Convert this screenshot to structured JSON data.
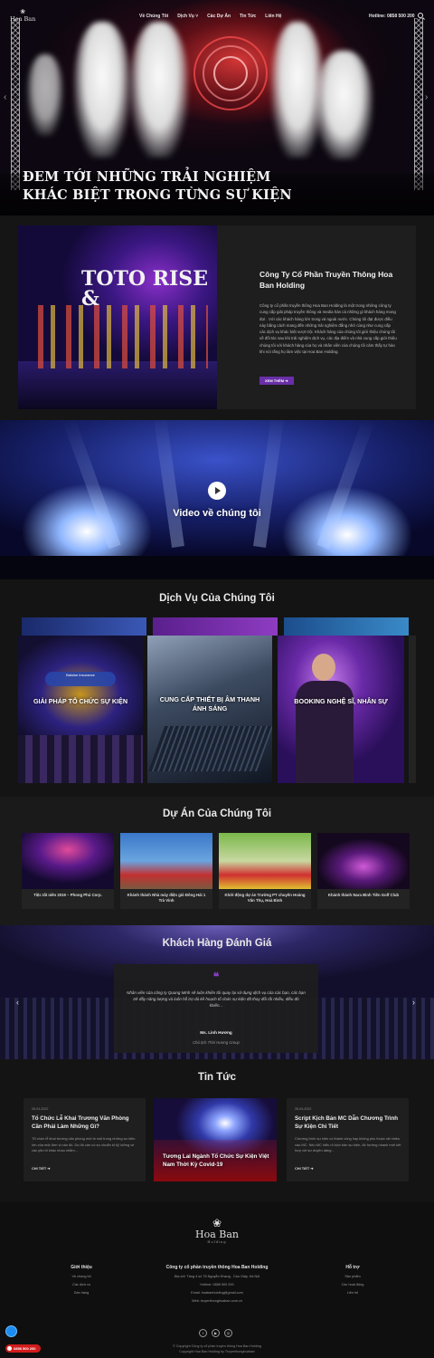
{
  "header": {
    "logo": "Hoa Ban",
    "nav": [
      "Về Chúng Tôi",
      "Dịch Vụ ˅",
      "Các Dự Án",
      "Tin Tức",
      "Liên Hệ"
    ],
    "hotline": "Hotline: 0858 500 200"
  },
  "hero": {
    "title_line1": "ĐEM TỚI NHỮNG TRẢI NGHIỆM",
    "title_line2": "KHÁC BIỆT TRONG TỪNG SỰ KIỆN"
  },
  "about": {
    "title": "Công Ty Cổ Phần Truyền Thông Hoa Ban Holding",
    "body": "Công ty cổ phần truyền thông Hoa Ban Holding là một trong những công ty cung cấp giải pháp truyền thông và media hàn cá những gì khách hàng mong đợi . Với các khách hàng lớn trong và ngoài nước. Chúng tôi đạt được điều này bằng cách mang đến những trải nghiệm đẳng nhớ cùng như cung cấp các dịch vụ khác biệt vượt trội. Khách hàng của chúng tôi giới thiệu chúng tôi về đối tác sau khi trải nghiệm dịch vụ, các địa điểm và nhà cung cấp giới thiệu chúng tôi với khách hàng của họ và nhân viên của chúng tôi cảm thấy tự hào khi nói rằng họ làm việc tại Hoa Ban Holding.",
    "button": "XEM THÊM ➜",
    "image_text": "TOTO RISE &"
  },
  "video": {
    "title": "Video về chúng tôi"
  },
  "services": {
    "title": "Dịch Vụ Của Chúng Tôi",
    "items": [
      {
        "label": "GIẢI PHÁP TỔ CHỨC SỰ KIỆN",
        "img_text": "Baloise Insurance"
      },
      {
        "label": "CUNG CẤP THIẾT BỊ ÂM THANH ÁNH SÁNG"
      },
      {
        "label": "BOOKING NGHỆ SĨ, NHÂN SỰ"
      }
    ]
  },
  "projects": {
    "title": "Dự Án Của Chúng Tôi",
    "items": [
      {
        "caption": "Tiệc tất niên 2019 – Phong Phú Corp."
      },
      {
        "caption": "Khánh thành Nhà máy điện gió Đông Hải 1 Trà Vinh"
      },
      {
        "caption": "Khởi động dự án Trường PT chuyên Hoàng Văn Thụ, Hoà Bình"
      },
      {
        "caption": "Khánh thành Nara Bình Tiên Golf Club"
      }
    ]
  },
  "reviews": {
    "title": "Khách Hàng Đánh Giá",
    "quote_mark": "❝",
    "text": "Nhân viên của công ty Quang Minh sẽ luôn khiến tôi quay lại sử dụng dịch vụ của các bạn, các bạn trẻ đầy năng lượng và luôn hỗ trợ dù kế hoạch tổ chức sự kiện đã thay đổi rồi nhiều, điều đó khiến...",
    "name": "Ms. Linh Hương",
    "role": "Chủ tịch Thời Hương Group"
  },
  "news": {
    "title": "Tin Tức",
    "items": [
      {
        "date": "26-04-2022",
        "title": "Tổ Chức Lễ Khai Trương Văn Phòng Cần Phải Làm Những Gì?",
        "body": "Tổ chức lễ khai trương văn phòng mới là một trong những sự kiện lớn của một đơn vị nào đó. Do đó cần có sự chuẩn bị kỹ lưỡng về các yếu tố khác nhau nhằm...",
        "more": "CHI TIẾT ➜"
      },
      {
        "title": "Tương Lai Ngành Tổ Chức Sự Kiện Việt Nam Thời Kỳ Covid-19"
      },
      {
        "date": "26-04-2022",
        "title": "Script Kịch Bản MC Dẫn Chương Trình Sự Kiện Chi Tiết",
        "body": "Chương trình sự kiện có thành công hay không phụ thuộc rất nhiều vào MC. Nếu MC hiểu rõ kịch bản sự kiện, đồ hướng nhanh mới kết hợp với sự duyên dáng...",
        "more": "CHI TIẾT ➜"
      }
    ]
  },
  "footer": {
    "logo": "Hoa Ban",
    "logo_sub": "Holding",
    "col1_title": "Giới thiệu",
    "col1_links": [
      "Về chúng tôi",
      "Các dịch vụ",
      "Dàn hàng"
    ],
    "col2_title": "Công ty cổ phần truyền thông Hoa Ban Holding",
    "col2_lines": [
      "Địa chỉ: Tầng 4 số 76 Nguyễn Khang , Cầu Giấy, Hà Nội",
      "Hotline: 0858 500 200",
      "Email: hoabanholding@gmail.com",
      "Web: truyenthonghoaban.com.vn"
    ],
    "col3_title": "Hỗ trợ",
    "col3_links": [
      "Sản phẩm",
      "Các hoạt động",
      "Liên hệ"
    ],
    "social": [
      "f",
      "▶",
      "◎"
    ],
    "copyright1": "© Copyright Công ty cổ phần truyền thông Hoa Ban Holding",
    "copyright2": "Copyright Hoa Ban Holding by Truyenthonghoaban",
    "call": "0858 500 200"
  },
  "colors": {
    "accent": "#6a2fa8",
    "quote": "#8a3ec6",
    "call": "#d21c1c"
  }
}
